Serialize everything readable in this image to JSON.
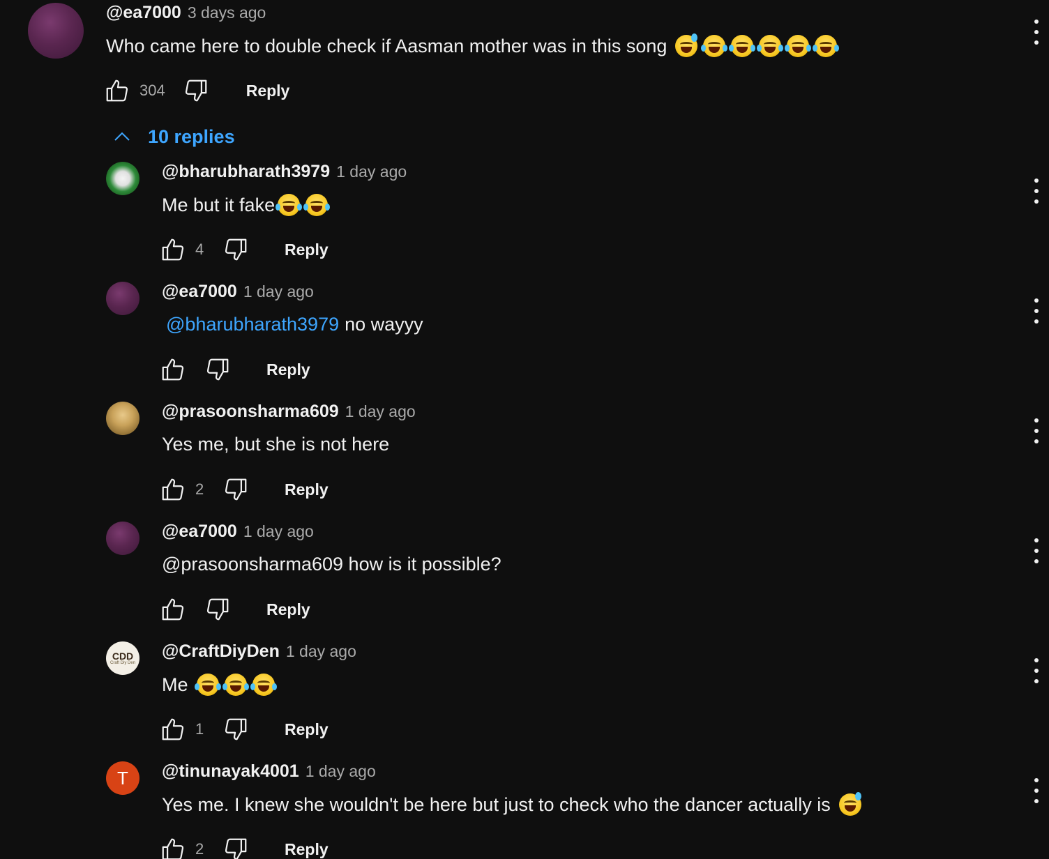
{
  "top_comment": {
    "author": "@ea7000",
    "time": "3 days ago",
    "text": "Who came here to double check if Aasman mother was in this song",
    "likes": "304",
    "reply_label": "Reply",
    "emojis": [
      "sweat",
      "laugh",
      "laugh",
      "laugh",
      "laugh",
      "laugh"
    ]
  },
  "replies_toggle": {
    "label": "10 replies",
    "icon": "chevron-up-icon"
  },
  "replies": [
    {
      "author": "@bharubharath3979",
      "time": "1 day ago",
      "mention": "",
      "text": "Me but it fake",
      "likes": "4",
      "reply_label": "Reply",
      "avatar": "joker",
      "emojis": [
        "laugh",
        "laugh"
      ]
    },
    {
      "author": "@ea7000",
      "time": "1 day ago",
      "mention": "@bharubharath3979",
      "text": "no wayyy",
      "likes": "",
      "reply_label": "Reply",
      "avatar": "purple",
      "emojis": []
    },
    {
      "author": "@prasoonsharma609",
      "time": "1 day ago",
      "mention": "",
      "text": "Yes me, but she is not here",
      "likes": "2",
      "reply_label": "Reply",
      "avatar": "prasoon",
      "emojis": []
    },
    {
      "author": "@ea7000",
      "time": "1 day ago",
      "mention": "",
      "text": "@prasoonsharma609 how is it possible?",
      "likes": "",
      "reply_label": "Reply",
      "avatar": "purple",
      "emojis": []
    },
    {
      "author": "@CraftDiyDen",
      "time": "1 day ago",
      "mention": "",
      "text": "Me",
      "likes": "1",
      "reply_label": "Reply",
      "avatar": "cdd",
      "emojis": [
        "laugh",
        "laugh",
        "laugh"
      ]
    },
    {
      "author": "@tinunayak4001",
      "time": "1 day ago",
      "mention": "",
      "text": "Yes me. I knew she wouldn't be here but just to check who the dancer actually is",
      "likes": "2",
      "reply_label": "Reply",
      "avatar": "T",
      "emojis": [
        "sweat"
      ]
    }
  ],
  "avatars": {
    "cdd_main": "CDD",
    "cdd_sub": "Craft Diy Den",
    "T": "T"
  },
  "colors": {
    "background": "#0f0f0f",
    "link": "#3ea6ff",
    "secondary_text": "#aaaaaa"
  }
}
